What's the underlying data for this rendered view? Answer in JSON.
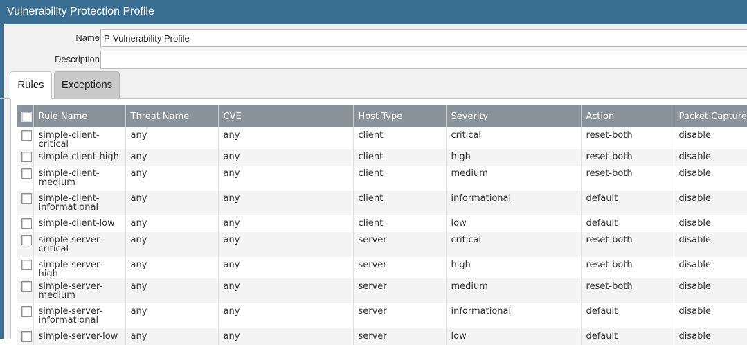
{
  "window": {
    "title": "Vulnerability Protection Profile"
  },
  "form": {
    "name_label": "Name",
    "name_value": "P-Vulnerability Profile",
    "description_label": "Description",
    "description_value": ""
  },
  "tabs": [
    {
      "label": "Rules",
      "active": true
    },
    {
      "label": "Exceptions",
      "active": false
    }
  ],
  "table": {
    "columns": [
      "Rule Name",
      "Threat Name",
      "CVE",
      "Host Type",
      "Severity",
      "Action",
      "Packet Capture"
    ],
    "rows": [
      {
        "rule_name": "simple-client-critical",
        "threat_name": "any",
        "cve": "any",
        "host_type": "client",
        "severity": "critical",
        "action": "reset-both",
        "packet_capture": "disable"
      },
      {
        "rule_name": "simple-client-high",
        "threat_name": "any",
        "cve": "any",
        "host_type": "client",
        "severity": "high",
        "action": "reset-both",
        "packet_capture": "disable"
      },
      {
        "rule_name": "simple-client-medium",
        "threat_name": "any",
        "cve": "any",
        "host_type": "client",
        "severity": "medium",
        "action": "reset-both",
        "packet_capture": "disable"
      },
      {
        "rule_name": "simple-client-informational",
        "threat_name": "any",
        "cve": "any",
        "host_type": "client",
        "severity": "informational",
        "action": "default",
        "packet_capture": "disable"
      },
      {
        "rule_name": "simple-client-low",
        "threat_name": "any",
        "cve": "any",
        "host_type": "client",
        "severity": "low",
        "action": "default",
        "packet_capture": "disable"
      },
      {
        "rule_name": "simple-server-critical",
        "threat_name": "any",
        "cve": "any",
        "host_type": "server",
        "severity": "critical",
        "action": "reset-both",
        "packet_capture": "disable"
      },
      {
        "rule_name": "simple-server-high",
        "threat_name": "any",
        "cve": "any",
        "host_type": "server",
        "severity": "high",
        "action": "reset-both",
        "packet_capture": "disable"
      },
      {
        "rule_name": "simple-server-medium",
        "threat_name": "any",
        "cve": "any",
        "host_type": "server",
        "severity": "medium",
        "action": "reset-both",
        "packet_capture": "disable"
      },
      {
        "rule_name": "simple-server-informational",
        "threat_name": "any",
        "cve": "any",
        "host_type": "server",
        "severity": "informational",
        "action": "default",
        "packet_capture": "disable"
      },
      {
        "rule_name": "simple-server-low",
        "threat_name": "any",
        "cve": "any",
        "host_type": "server",
        "severity": "low",
        "action": "default",
        "packet_capture": "disable"
      }
    ]
  },
  "colors": {
    "titlebar": "#3a6f93",
    "table_header": "#8a9399",
    "inactive_tab": "#c9c9c9"
  }
}
